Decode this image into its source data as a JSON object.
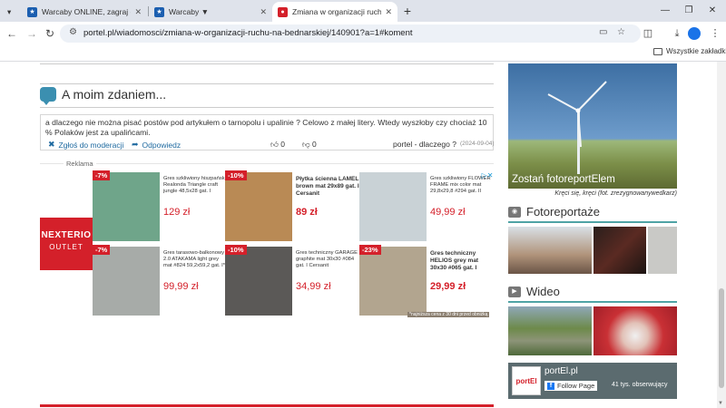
{
  "browser": {
    "tabs": [
      {
        "title": "Warcaby ONLINE, zagraj - Kurn",
        "favicon_color": "#1c5fb0"
      },
      {
        "title": "Warcaby ▼",
        "favicon_color": "#1c5fb0"
      },
      {
        "title": "Zmiana w organizacji ruchu na",
        "favicon_color": "#d4202a",
        "active": true
      }
    ],
    "url": "portel.pl/wiadomosci/zmiana-w-organizacji-ruchu-na-bednarskiej/140901?a=1#koment",
    "bookmarks_folder": "Wszystkie zakładki"
  },
  "opinion": {
    "title": "A moim zdaniem...",
    "comment": {
      "text": "a dlaczego nie można pisać postów pod artykułem o tarnopolu i upalinie ? Celowo z małej litery. Wtedy wyszłoby czy chociaż 10 % Polaków jest za upalińcami.",
      "report": "Zgłoś do moderacji",
      "reply": "Odpowiedz",
      "likes": "0",
      "dislikes": "0",
      "author": "portel - dlaczego ?",
      "date": "(2024-09-04)"
    }
  },
  "ad": {
    "label": "Reklama",
    "brand": "NEXTERIO",
    "brand_sub": "OUTLET",
    "note": "*najniższa cena z 30 dni przed obniżką",
    "products": [
      {
        "discount": "-7%",
        "name": "Gres szkliwiony hiszpański Realonda Triangle craft jungle 48,5x28 gat. I",
        "price": "129 zł",
        "bold": false,
        "img": "#6fa58a"
      },
      {
        "discount": "-10%",
        "name": "Płytka ścienna LAMEL brown mat 29x89 gat. I Cersanit",
        "price": "89 zł",
        "bold": true,
        "img": "#b98a55"
      },
      {
        "discount": "",
        "name": "Gres szkliwiony FLOWER FRAME mix color mat 29,8x29,8 #294 gat. II",
        "price": "49,99 zł",
        "bold": false,
        "img": "#c9d2d6"
      },
      {
        "discount": "-7%",
        "name": "Gres tarasowo-balkonowy 2.0 ATAKAMA light grey mat #824 59,2x59,2 gat. I*",
        "price": "99,99 zł",
        "bold": false,
        "img": "#a7aba8"
      },
      {
        "discount": "-10%",
        "name": "Gres techniczny GARAGE graphite mat 30x30 #084 gat. I Cersanit",
        "price": "34,99 zł",
        "bold": false,
        "img": "#5b5957"
      },
      {
        "discount": "-23%",
        "name": "Gres techniczny HELIOS grey mat 30x30 #065 gat. I",
        "price": "29,99 zł",
        "bold": true,
        "img": "#b2a58f"
      }
    ]
  },
  "sidebar": {
    "promo_title": "Zostań fotoreportElem",
    "promo_caption": "Kręci się, kręci (fot. zrezygnowanywedkarz)",
    "photo_section": "Fotoreportaże",
    "video_section": "Wideo",
    "fb_name": "portEl.pl",
    "fb_follow": "Follow Page",
    "fb_followers": "41 tys. obserwujący"
  }
}
